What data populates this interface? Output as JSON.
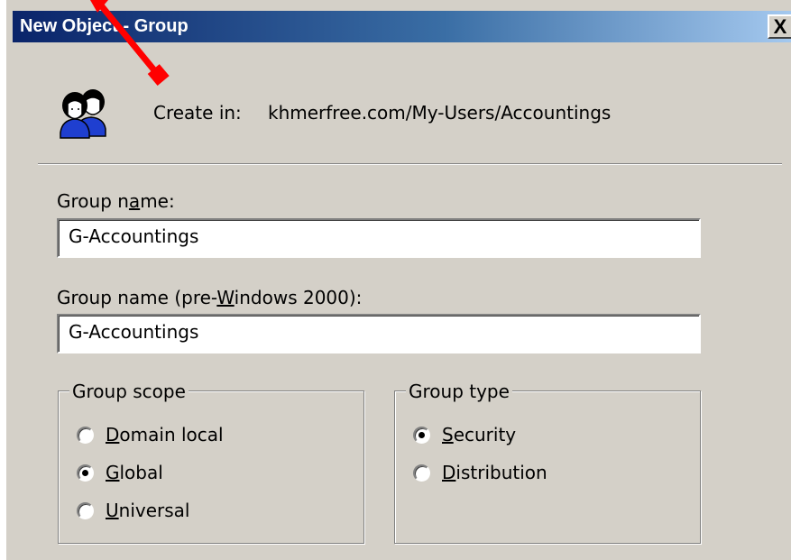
{
  "window": {
    "title": "New Object - Group",
    "close_label": "X",
    "icon": "group-users-icon"
  },
  "create_in": {
    "label": "Create in:",
    "path": "khmerfree.com/My-Users/Accountings"
  },
  "group_name": {
    "label_parts": [
      "Group n",
      "a",
      "me:"
    ],
    "value": "G-Accountings"
  },
  "group_name_pre2000": {
    "label_parts": [
      "Group name (pre-",
      "W",
      "indows 2000):"
    ],
    "value": "G-Accountings"
  },
  "group_scope": {
    "legend": "Group scope",
    "options": [
      {
        "mnemonic": "D",
        "rest": "omain local",
        "checked": false
      },
      {
        "mnemonic": "G",
        "rest": "lobal",
        "checked": true
      },
      {
        "mnemonic": "U",
        "rest": "niversal",
        "checked": false
      }
    ]
  },
  "group_type": {
    "legend": "Group type",
    "options": [
      {
        "mnemonic": "S",
        "rest": "ecurity",
        "checked": true
      },
      {
        "mnemonic": "D",
        "rest": "istribution",
        "checked": false
      }
    ]
  },
  "colors": {
    "dialog_bg": "#d4d0c8",
    "title_gradient_start": "#0a246a",
    "title_gradient_end": "#a6caf0",
    "annotation_arrow": "#ff0000"
  }
}
